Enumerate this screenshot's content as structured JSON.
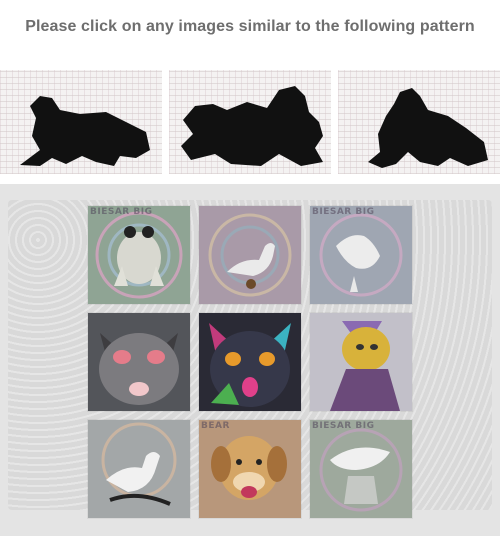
{
  "prompt": "Please click on any images similar to the following pattern",
  "pattern_images": [
    {
      "subject": "frog silhouette",
      "icon": "frog-silhouette-icon"
    },
    {
      "subject": "frog silhouette",
      "icon": "frog-silhouette-icon"
    },
    {
      "subject": "frog silhouette",
      "icon": "frog-silhouette-icon"
    }
  ],
  "grid_tiles": [
    {
      "subject": "frog",
      "icon": "frog-icon",
      "watermark": "BIESAR BIG"
    },
    {
      "subject": "duck",
      "icon": "duck-icon",
      "watermark": ""
    },
    {
      "subject": "duck",
      "icon": "duck-icon",
      "watermark": "BIESAR BIG"
    },
    {
      "subject": "cat",
      "icon": "cat-icon",
      "watermark": ""
    },
    {
      "subject": "cat",
      "icon": "cat-icon",
      "watermark": ""
    },
    {
      "subject": "cat",
      "icon": "cat-icon",
      "watermark": ""
    },
    {
      "subject": "duck",
      "icon": "duck-icon",
      "watermark": ""
    },
    {
      "subject": "dog",
      "icon": "dog-icon",
      "watermark": "BEAR"
    },
    {
      "subject": "duck",
      "icon": "duck-icon",
      "watermark": "BIESAR BIG"
    }
  ]
}
